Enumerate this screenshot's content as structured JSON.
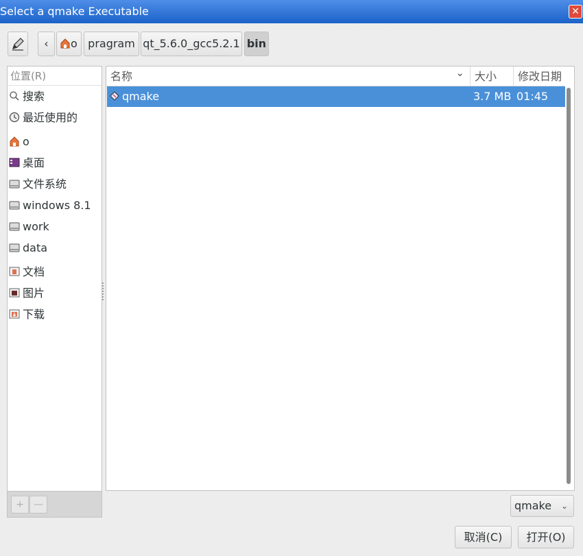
{
  "window": {
    "title": "Select a qmake Executable",
    "close_glyph": "✕"
  },
  "toolbar": {
    "edit_icon": "pencil-icon",
    "back_glyph": "‹",
    "home_icon": "home-icon",
    "breadcrumbs": [
      "o",
      "pragram",
      "qt_5.6.0_gcc5.2.1",
      "bin"
    ]
  },
  "sidebar": {
    "header": "位置(R)",
    "items": [
      {
        "label": "搜索",
        "icon": "search-icon"
      },
      {
        "label": "最近使用的",
        "icon": "recent-icon"
      },
      {
        "label": "o",
        "icon": "home-icon"
      },
      {
        "label": "桌面",
        "icon": "desktop-icon"
      },
      {
        "label": "文件系统",
        "icon": "drive-icon"
      },
      {
        "label": "windows 8.1",
        "icon": "drive-icon"
      },
      {
        "label": "work",
        "icon": "drive-icon"
      },
      {
        "label": "data",
        "icon": "drive-icon"
      },
      {
        "label": "文档",
        "icon": "documents-icon"
      },
      {
        "label": "图片",
        "icon": "pictures-icon"
      },
      {
        "label": "下载",
        "icon": "downloads-icon"
      }
    ],
    "add_glyph": "+",
    "remove_glyph": "—"
  },
  "filelist": {
    "columns": {
      "name": "名称",
      "size": "大小",
      "modified": "修改日期",
      "sort_glyph": "⌄"
    },
    "rows": [
      {
        "name": "qmake",
        "size": "3.7 MB",
        "modified": "01:45",
        "icon": "executable-icon",
        "selected": true
      }
    ]
  },
  "filter": {
    "value": "qmake",
    "arrow": "⌄"
  },
  "actions": {
    "cancel": "取消(C)",
    "open": "打开(O)"
  },
  "colors": {
    "selection": "#4a90d9",
    "titlebar": "#1b62c8",
    "close": "#e04a3a"
  }
}
